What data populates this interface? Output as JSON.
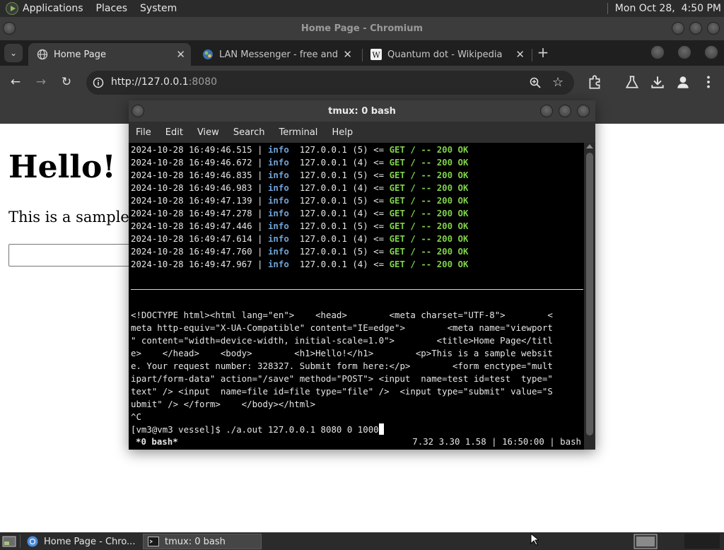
{
  "panel": {
    "menus": [
      "Applications",
      "Places",
      "System"
    ],
    "clock": "Mon Oct 28,  4:50 PM"
  },
  "browser": {
    "window_title": "Home Page - Chromium",
    "tabs": [
      {
        "title": "Home Page",
        "favicon": "globe-icon",
        "active": true
      },
      {
        "title": "LAN Messenger - free and op",
        "favicon": "lan-messenger-icon",
        "active": false
      },
      {
        "title": "Quantum dot - Wikipedia",
        "favicon": "wikipedia-icon",
        "active": false
      }
    ],
    "url_host": "http://127.0.0.1",
    "url_port": ":8080",
    "page": {
      "heading": "Hello!",
      "paragraph": "This is a sample w"
    }
  },
  "terminal": {
    "window_title": "tmux: 0 bash",
    "menu": [
      "File",
      "Edit",
      "View",
      "Search",
      "Terminal",
      "Help"
    ],
    "log_lines": [
      {
        "ts": "2024-10-28 16:49:46.515",
        "level": "info",
        "addr": "127.0.0.1 (5) <= ",
        "req": "GET / -- 200 OK"
      },
      {
        "ts": "2024-10-28 16:49:46.672",
        "level": "info",
        "addr": "127.0.0.1 (4) <= ",
        "req": "GET / -- 200 OK"
      },
      {
        "ts": "2024-10-28 16:49:46.835",
        "level": "info",
        "addr": "127.0.0.1 (5) <= ",
        "req": "GET / -- 200 OK"
      },
      {
        "ts": "2024-10-28 16:49:46.983",
        "level": "info",
        "addr": "127.0.0.1 (4) <= ",
        "req": "GET / -- 200 OK"
      },
      {
        "ts": "2024-10-28 16:49:47.139",
        "level": "info",
        "addr": "127.0.0.1 (5) <= ",
        "req": "GET / -- 200 OK"
      },
      {
        "ts": "2024-10-28 16:49:47.278",
        "level": "info",
        "addr": "127.0.0.1 (4) <= ",
        "req": "GET / -- 200 OK"
      },
      {
        "ts": "2024-10-28 16:49:47.446",
        "level": "info",
        "addr": "127.0.0.1 (5) <= ",
        "req": "GET / -- 200 OK"
      },
      {
        "ts": "2024-10-28 16:49:47.614",
        "level": "info",
        "addr": "127.0.0.1 (4) <= ",
        "req": "GET / -- 200 OK"
      },
      {
        "ts": "2024-10-28 16:49:47.760",
        "level": "info",
        "addr": "127.0.0.1 (5) <= ",
        "req": "GET / -- 200 OK"
      },
      {
        "ts": "2024-10-28 16:49:47.967",
        "level": "info",
        "addr": "127.0.0.1 (4) <= ",
        "req": "GET / -- 200 OK"
      }
    ],
    "html_output_lines": [
      "<!DOCTYPE html><html lang=\"en\">    <head>        <meta charset=\"UTF-8\">        <",
      "meta http-equiv=\"X-UA-Compatible\" content=\"IE=edge\">        <meta name=\"viewport",
      "\" content=\"width=device-width, initial-scale=1.0\">        <title>Home Page</titl",
      "e>    </head>    <body>        <h1>Hello!</h1>        <p>This is a sample websit",
      "e. Your request number: 328327. Submit form here:</p>        <form enctype=\"mult",
      "ipart/form-data\" action=\"/save\" method=\"POST\"> <input  name=test id=test  type=\"",
      "text\" /> <input  name=file id=file type=\"file\" />  <input type=\"submit\" value=\"S",
      "ubmit\" /> </form>    </body></html>",
      "^C"
    ],
    "prompt": "[vm3@vm3 vessel]$ ",
    "command": "./a.out 127.0.0.1 8080 0 1000",
    "status_left": "*0 bash*",
    "status_right": "7.32 3.30 1.58 | 16:50:00 | bash"
  },
  "taskbar": {
    "items": [
      {
        "label": "Home Page - Chro...",
        "icon": "chromium-icon",
        "active": false
      },
      {
        "label": "tmux: 0 bash",
        "icon": "terminal-icon",
        "active": true
      }
    ]
  }
}
